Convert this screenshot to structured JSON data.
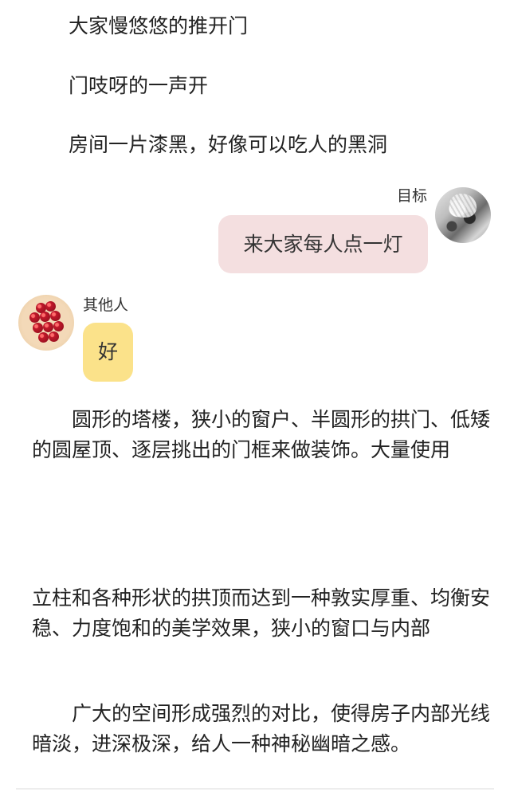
{
  "narration": {
    "line1": "大家慢悠悠的推开门",
    "line2": "门吱呀的一声开",
    "line3": "房间一片漆黑，好像可以吃人的黑洞"
  },
  "messages": {
    "target": {
      "speaker": "目标",
      "text": "来大家每人点一灯",
      "bubble_color": "#f4dfe0",
      "avatar_icon": "anime-avatar-icon"
    },
    "others": {
      "speaker": "其他人",
      "text": "好",
      "bubble_color": "#fbe28a",
      "avatar_icon": "berry-pastry-avatar-icon"
    }
  },
  "body_text": {
    "p1": "　　圆形的塔楼，狭小的窗户、半圆形的拱门、低矮的圆屋顶、逐层挑出的门框来做装饰。大量使用",
    "p2": "立柱和各种形状的拱顶而达到一种敦实厚重、均衡安稳、力度饱和的美学效果，狭小的窗口与内部",
    "p3": "　　广大的空间形成强烈的对比，使得房子内部光线暗淡，进深极深，给人一种神秘幽暗之感。"
  }
}
